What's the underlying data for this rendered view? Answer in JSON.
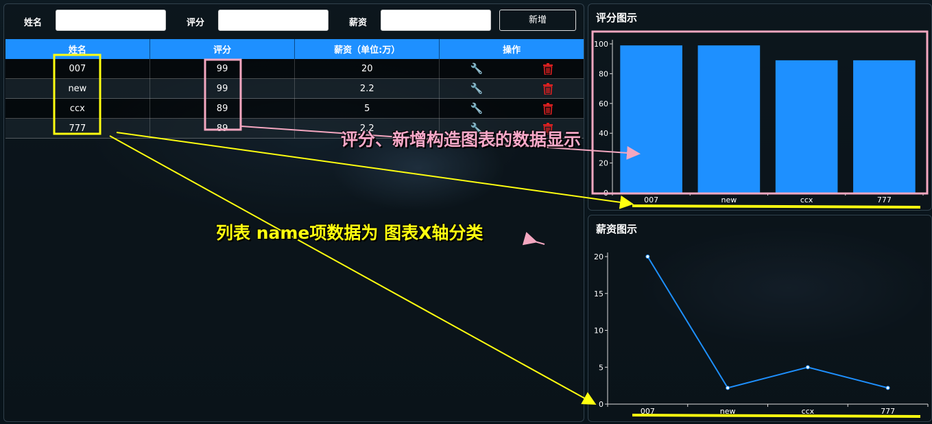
{
  "form": {
    "name_label": "姓名",
    "score_label": "评分",
    "salary_label": "薪资",
    "name_value": "",
    "score_value": "",
    "salary_value": "",
    "add_button": "新增"
  },
  "table": {
    "columns": [
      "姓名",
      "评分",
      "薪资（单位:万）",
      "操作"
    ],
    "rows": [
      {
        "name": "007",
        "score": "99",
        "salary": "20"
      },
      {
        "name": "new",
        "score": "99",
        "salary": "2.2"
      },
      {
        "name": "ccx",
        "score": "89",
        "salary": "5"
      },
      {
        "name": "777",
        "score": "89",
        "salary": "2.2"
      }
    ],
    "edit_icon": "wrench-icon",
    "delete_icon": "trash-icon",
    "edit_color": "#1e90ff",
    "delete_color": "#e02020"
  },
  "score_chart": {
    "title": "评分图示"
  },
  "salary_chart": {
    "title": "薪资图示"
  },
  "chart_data": [
    {
      "type": "bar",
      "title": "评分图示",
      "categories": [
        "007",
        "new",
        "ccx",
        "777"
      ],
      "values": [
        99,
        99,
        89,
        89
      ],
      "ylim": [
        0,
        100
      ],
      "yticks": [
        0,
        20,
        40,
        60,
        80,
        100
      ],
      "color": "#1e90ff"
    },
    {
      "type": "line",
      "title": "薪资图示",
      "categories": [
        "007",
        "new",
        "ccx",
        "777"
      ],
      "values": [
        20,
        2.2,
        5,
        2.2
      ],
      "ylim": [
        0,
        20
      ],
      "yticks": [
        0,
        5,
        10,
        15,
        20
      ],
      "color": "#1e90ff"
    }
  ],
  "annotations": {
    "note1": "评分、新增构造图表的数据显示",
    "note2": "列表 name项数据为 图表X轴分类",
    "pink": "#f4a7c0",
    "yellow": "#ffff10"
  }
}
